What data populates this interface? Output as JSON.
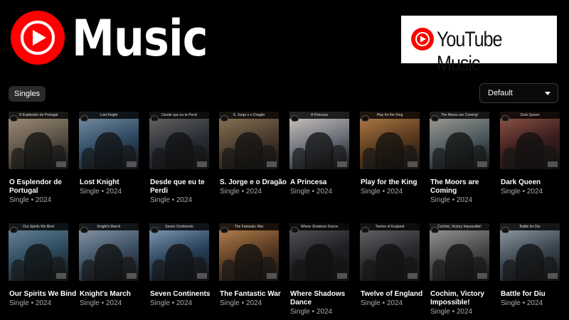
{
  "header": {
    "logo_text": "Music",
    "badge_text": "YouTube Music",
    "brand_red": "#ff0000"
  },
  "filter": {
    "chip_label": "Singles",
    "sort_label": "Default"
  },
  "rows": [
    [
      {
        "thumb_title": "O Esplendor de Portugal",
        "title": "O Esplendor de Portugal",
        "meta": "Single • 2024",
        "colors": [
          "#5b5246",
          "#a89580"
        ]
      },
      {
        "thumb_title": "Lost Knight",
        "title": "Lost Knight",
        "meta": "Single • 2024",
        "colors": [
          "#2f4a63",
          "#7d94a7"
        ]
      },
      {
        "thumb_title": "Desde que eu te Perdi",
        "title": "Desde que eu te Perdi",
        "meta": "Single • 2024",
        "colors": [
          "#2a2f38",
          "#6f6a66"
        ]
      },
      {
        "thumb_title": "S. Jorge e o Dragão",
        "title": "S. Jorge e o Dragão",
        "meta": "Single • 2024",
        "colors": [
          "#4a3b2c",
          "#8e7a5a"
        ]
      },
      {
        "thumb_title": "A Princesa",
        "title": "A Princesa",
        "meta": "Single • 2024",
        "colors": [
          "#6a6f7a",
          "#d6cbc4"
        ]
      },
      {
        "thumb_title": "Play for the King",
        "title": "Play for the King",
        "meta": "Single • 2024",
        "colors": [
          "#5a3a1e",
          "#b8824a"
        ]
      },
      {
        "thumb_title": "The Moors are Coming!",
        "title": "The Moors are Coming",
        "meta": "Single • 2024",
        "colors": [
          "#4c5a5e",
          "#a7a39a"
        ]
      },
      {
        "thumb_title": "Dark Queen",
        "title": "Dark Queen",
        "meta": "Single • 2024",
        "colors": [
          "#3a1e1e",
          "#9a5a4a"
        ]
      }
    ],
    [
      {
        "thumb_title": "Our Spirits We Bind",
        "title": "Our Spirits We Bind",
        "meta": "Single • 2024",
        "colors": [
          "#2d4a5c",
          "#6d8aa0"
        ]
      },
      {
        "thumb_title": "Knight's March",
        "title": "Knight's March",
        "meta": "Single • 2024",
        "colors": [
          "#3c4e61",
          "#8ea0b0"
        ]
      },
      {
        "thumb_title": "Seven Continents",
        "title": "Seven Continents",
        "meta": "Single • 2024",
        "colors": [
          "#28405a",
          "#8aa6c0"
        ]
      },
      {
        "thumb_title": "The Fantastic War",
        "title": "The Fantastic War",
        "meta": "Single • 2024",
        "colors": [
          "#5a3a22",
          "#c08a52"
        ]
      },
      {
        "thumb_title": "Where Shadows Dance",
        "title": "Where Shadows Dance",
        "meta": "Single • 2024",
        "colors": [
          "#1e2024",
          "#5a5a5e"
        ]
      },
      {
        "thumb_title": "Twelve of England",
        "title": "Twelve of England",
        "meta": "Single • 2024",
        "colors": [
          "#2a2a2e",
          "#6a6a70"
        ]
      },
      {
        "thumb_title": "Cochim, Victory Impossible!",
        "title": "Cochim, Victory Impossible!",
        "meta": "Single • 2024",
        "colors": [
          "#4a4a4a",
          "#a0a0a0"
        ]
      },
      {
        "thumb_title": "Battle for Diu",
        "title": "Battle for Diu",
        "meta": "Single • 2024",
        "colors": [
          "#3a4550",
          "#9aa4ac"
        ]
      }
    ]
  ]
}
